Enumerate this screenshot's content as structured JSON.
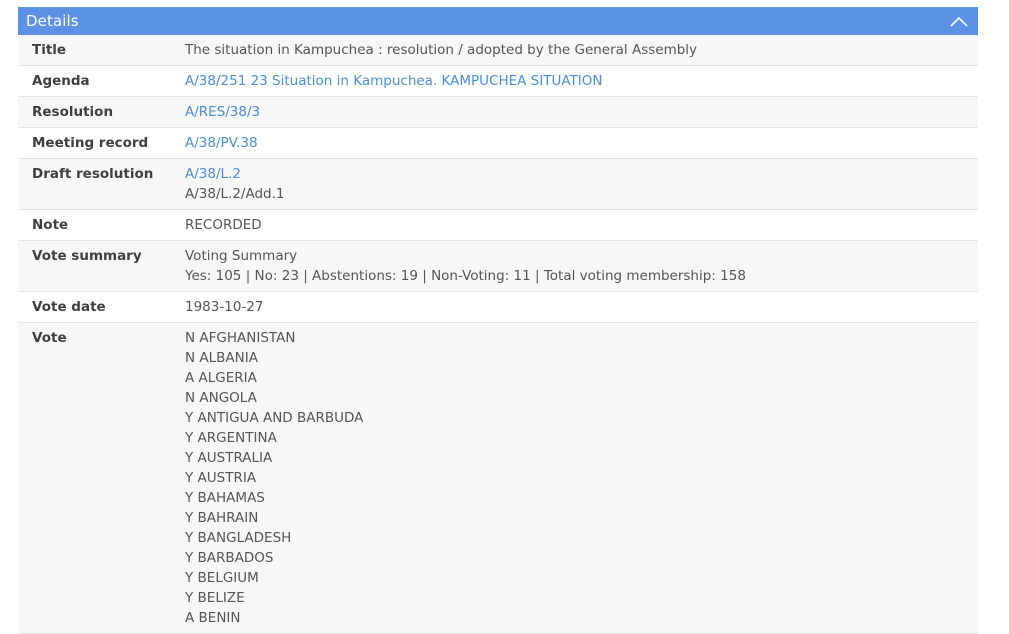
{
  "panel": {
    "title": "Details",
    "collapse_icon": "chevron-up-icon"
  },
  "rows": {
    "title": {
      "label": "Title",
      "value": "The situation in Kampuchea : resolution / adopted by the General Assembly"
    },
    "agenda": {
      "label": "Agenda",
      "link": "A/38/251 23 Situation in Kampuchea. KAMPUCHEA SITUATION"
    },
    "resolution": {
      "label": "Resolution",
      "link": "A/RES/38/3"
    },
    "meeting_record": {
      "label": "Meeting record",
      "link": "A/38/PV.38"
    },
    "draft_resolution": {
      "label": "Draft resolution",
      "link": "A/38/L.2",
      "extra": "A/38/L.2/Add.1"
    },
    "note": {
      "label": "Note",
      "value": "RECORDED"
    },
    "vote_summary": {
      "label": "Vote summary",
      "heading": "Voting Summary",
      "detail": "Yes: 105 | No: 23 | Abstentions: 19 | Non-Voting: 11 | Total voting membership: 158"
    },
    "vote_date": {
      "label": "Vote date",
      "value": "1983-10-27"
    },
    "vote": {
      "label": "Vote",
      "entries": [
        "N AFGHANISTAN",
        "N ALBANIA",
        "A ALGERIA",
        "N ANGOLA",
        "Y ANTIGUA AND BARBUDA",
        "Y ARGENTINA",
        "Y AUSTRALIA",
        "Y AUSTRIA",
        "Y BAHAMAS",
        "Y BAHRAIN",
        "Y BANGLADESH",
        "Y BARBADOS",
        "Y BELGIUM",
        "Y BELIZE",
        "A BENIN"
      ]
    }
  },
  "colors": {
    "header_bg": "#5b92e5",
    "link": "#4a8fd6",
    "row_alt": "#f7f7f7"
  }
}
